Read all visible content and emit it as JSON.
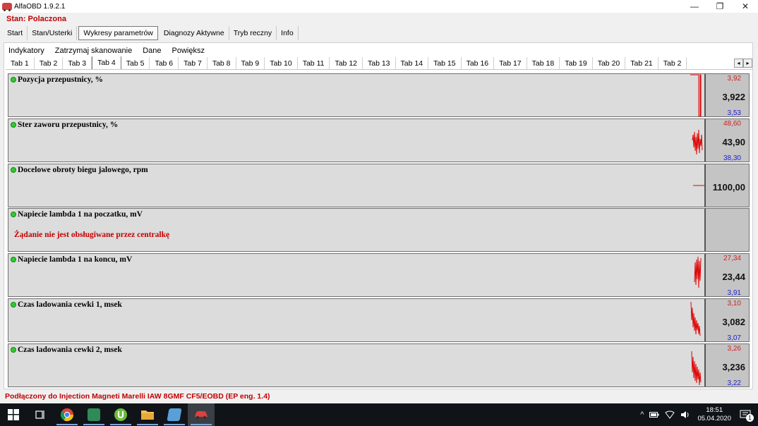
{
  "window": {
    "title": "AlfaOBD 1.9.2.1",
    "minimize": "—",
    "maximize": "❐",
    "close": "✕"
  },
  "status_top": "Stan: Polaczona",
  "menu": [
    "Start",
    "Stan/Usterki",
    "Wykresy parametrów",
    "Diagnozy Aktywne",
    "Tryb reczny",
    "Info"
  ],
  "submenu": [
    "Indykatory",
    "Zatrzymaj skanowanie",
    "Dane",
    "Powiększ"
  ],
  "tabs": [
    "Tab 1",
    "Tab 2",
    "Tab 3",
    "Tab 4",
    "Tab 5",
    "Tab 6",
    "Tab 7",
    "Tab 8",
    "Tab 9",
    "Tab 10",
    "Tab 11",
    "Tab 12",
    "Tab 13",
    "Tab 14",
    "Tab 15",
    "Tab 16",
    "Tab 17",
    "Tab 18",
    "Tab 19",
    "Tab 20",
    "Tab 21",
    "Tab 2"
  ],
  "tab_scroll": {
    "left": "◂",
    "right": "▸"
  },
  "params": [
    {
      "label": "Pozycja przepustnicy, %",
      "max": "3,92",
      "value": "3,922",
      "min": "3,53"
    },
    {
      "label": "Ster zaworu przepustnicy, %",
      "max": "48,60",
      "value": "43,90",
      "min": "38,30"
    },
    {
      "label": "Docelowe obroty biegu jalowego, rpm",
      "max": "",
      "value": "1100,00",
      "min": ""
    },
    {
      "label": "Napiecie lambda 1 na poczatku, mV",
      "max": "",
      "value": "",
      "min": "",
      "message": "Żądanie nie jest obsługiwane przez centralkę"
    },
    {
      "label": "Napiecie lambda 1 na koncu, mV",
      "max": "27,34",
      "value": "23,44",
      "min": "3,91"
    },
    {
      "label": "Czas ladowania cewki 1, msek",
      "max": "3,10",
      "value": "3,082",
      "min": "3,07"
    },
    {
      "label": "Czas ladowania cewki 2, msek",
      "max": "3,26",
      "value": "3,236",
      "min": "3,22"
    }
  ],
  "footer_status": "Podłączony do Injection Magneti Marelli IAW 8GMF CF5/EOBD (EP eng. 1.4)",
  "taskbar": {
    "clock_time": "18:51",
    "clock_date": "05.04.2020",
    "notification_count": "1",
    "tray_chevron": "^",
    "colors": {
      "background": "#101418",
      "accent": "#7aa7d8"
    }
  }
}
